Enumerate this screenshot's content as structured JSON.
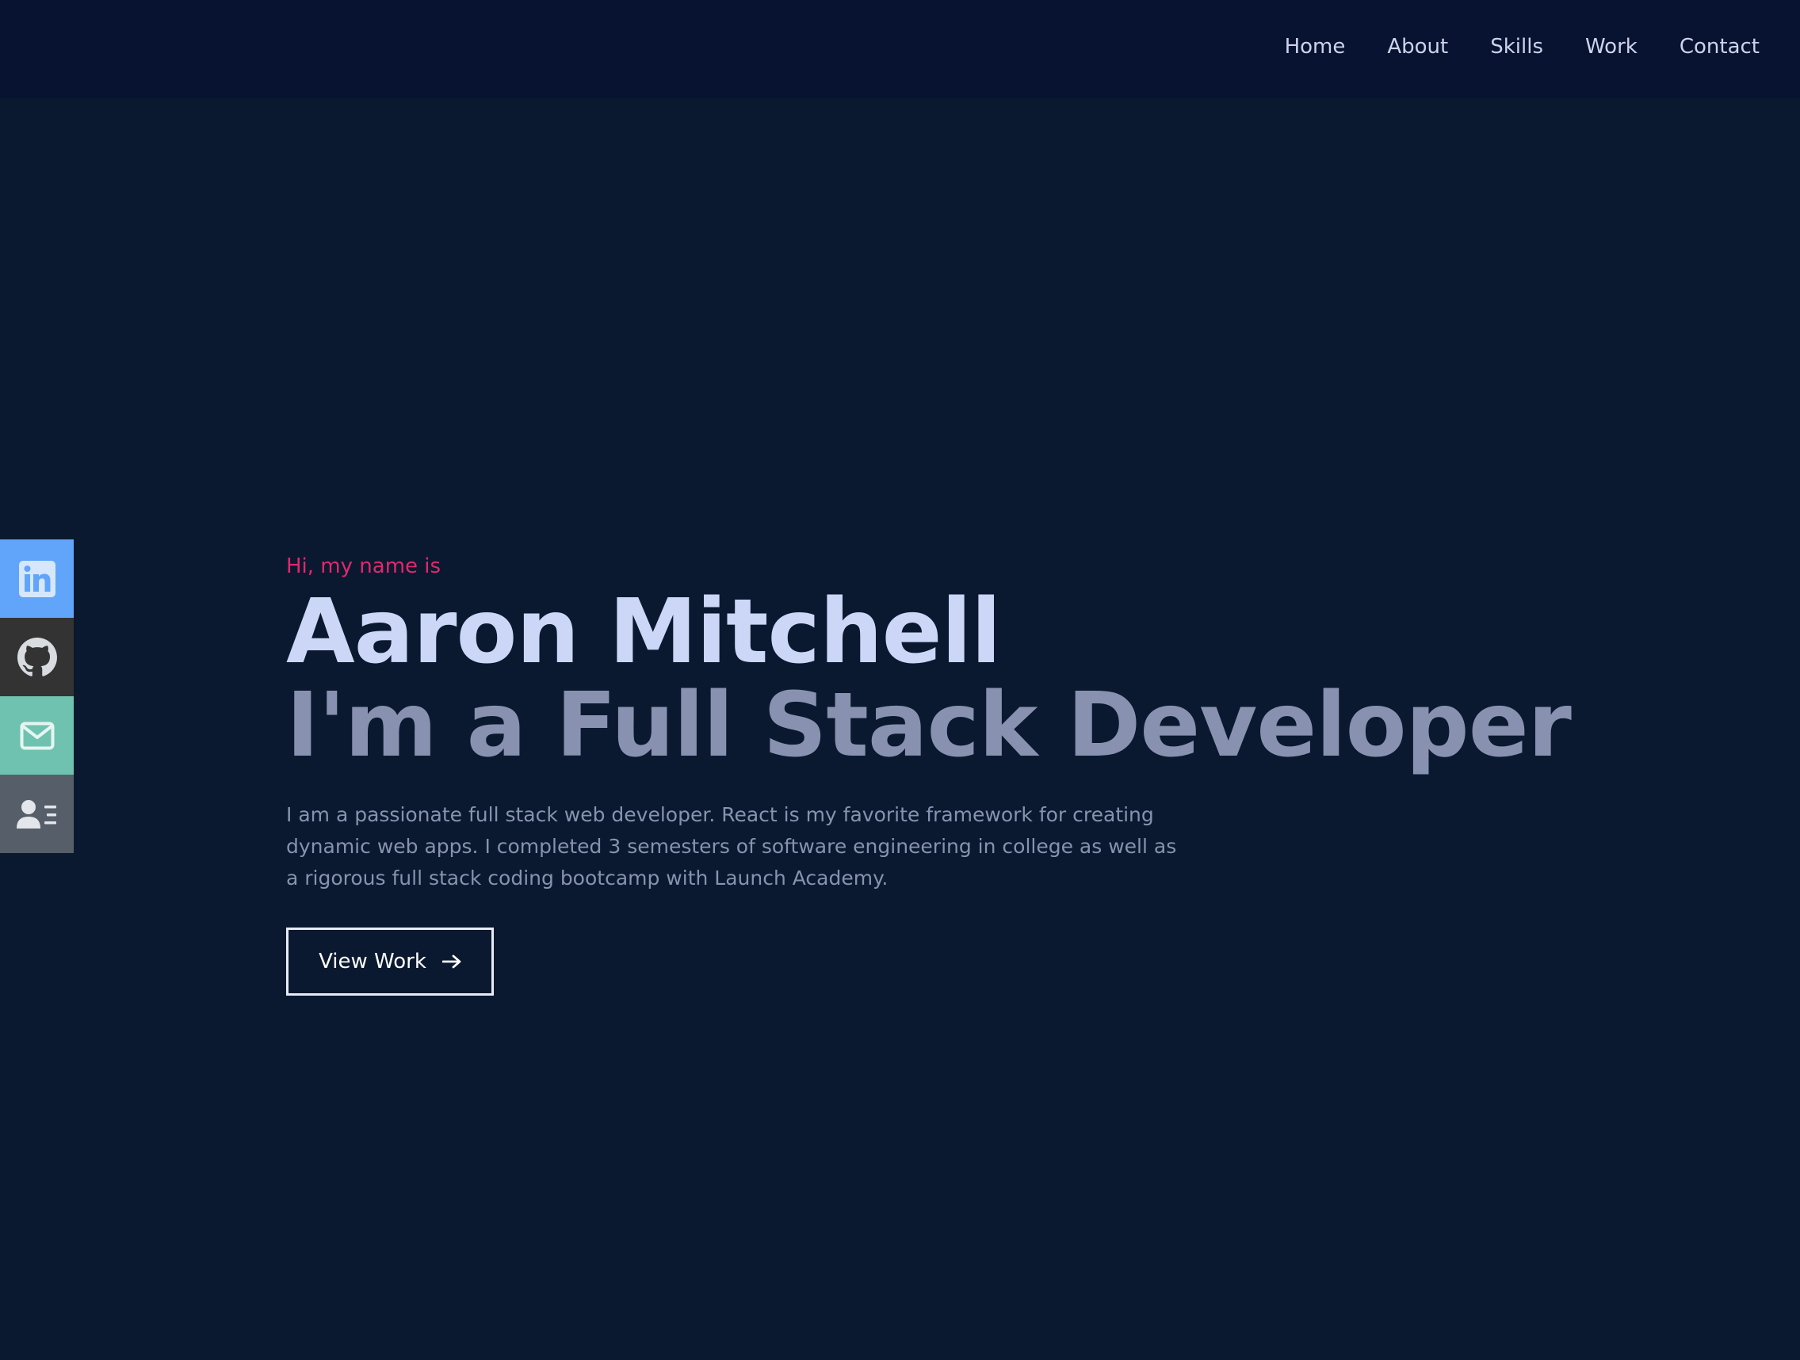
{
  "nav": {
    "links": [
      "Home",
      "About",
      "Skills",
      "Work",
      "Contact"
    ]
  },
  "social": [
    {
      "icon": "linkedin-icon",
      "color": "#60a5fa"
    },
    {
      "icon": "github-icon",
      "color": "#333333"
    },
    {
      "icon": "mail-icon",
      "color": "#6fc2b0"
    },
    {
      "icon": "contact-card-icon",
      "color": "#565f69"
    }
  ],
  "hero": {
    "greeting": "Hi, my name is",
    "name": "Aaron Mitchell",
    "role": "I'm a Full Stack Developer",
    "description": "I am a passionate full stack web developer. React is my favorite framework for creating dynamic web apps. I completed 3 semesters of software engineering in college as well as a rigorous full stack coding bootcamp with Launch Academy.",
    "cta_label": "View Work",
    "cta_icon": "arrow-right-icon"
  },
  "colors": {
    "background": "#0a192f",
    "navbar": "#071330",
    "accent": "#e0286e",
    "heading": "#ccd6f6",
    "muted": "#8892b0"
  }
}
